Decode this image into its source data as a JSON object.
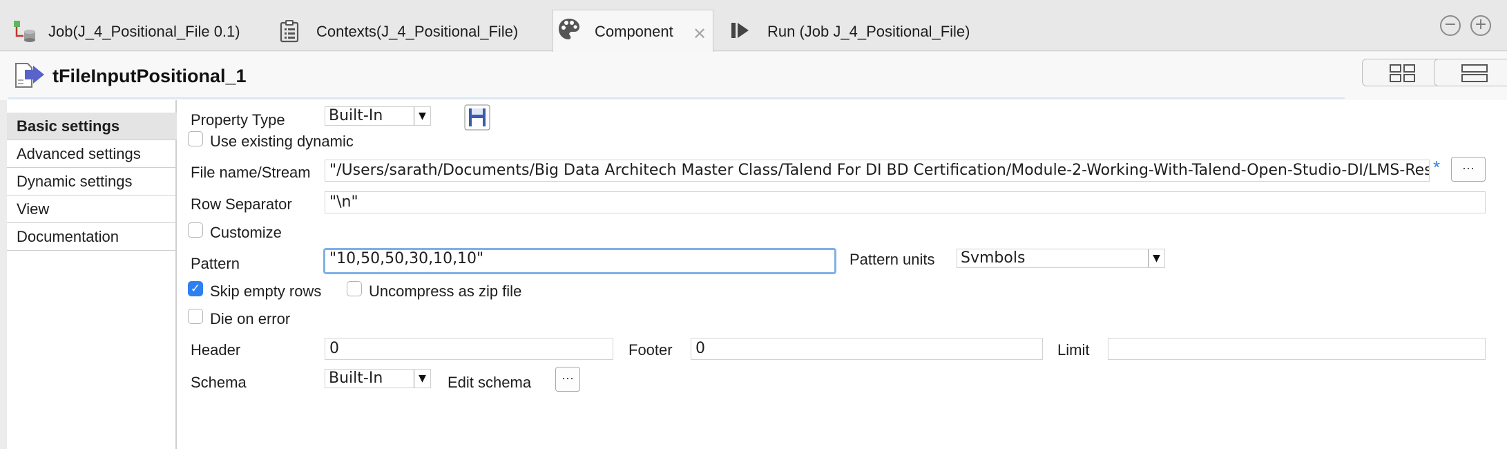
{
  "tabs": [
    {
      "label": "Job(J_4_Positional_File 0.1)",
      "icon": "job-icon"
    },
    {
      "label": "Contexts(J_4_Positional_File)",
      "icon": "clipboard-icon"
    },
    {
      "label": "Component",
      "icon": "palette-icon",
      "close": "✕"
    },
    {
      "label": "Run (Job J_4_Positional_File)",
      "icon": "run-icon"
    }
  ],
  "window_controls": {
    "minimize": "−",
    "maximize": "+"
  },
  "component": {
    "title": "tFileInputPositional_1"
  },
  "sidebar": {
    "items": [
      {
        "label": "Basic settings"
      },
      {
        "label": "Advanced settings"
      },
      {
        "label": "Dynamic settings"
      },
      {
        "label": "View"
      },
      {
        "label": "Documentation"
      }
    ]
  },
  "form": {
    "property_type": {
      "label": "Property Type",
      "value": "Built-In"
    },
    "use_existing_dynamic": {
      "label": "Use existing dynamic",
      "checked": false
    },
    "file_name": {
      "label": "File name/Stream",
      "value": "\"/Users/sarath/Documents/Big Data Architech Master Class/Talend For DI BD Certification/Module-2-Working-With-Talend-Open-Studio-DI/LMS-Resour",
      "modified_marker": "*",
      "browse": "···"
    },
    "row_separator": {
      "label": "Row Separator",
      "value": "\"\\n\""
    },
    "customize": {
      "label": "Customize",
      "checked": false
    },
    "pattern": {
      "label": "Pattern",
      "value": "\"10,50,50,30,10,10\""
    },
    "pattern_units": {
      "label": "Pattern units",
      "value": "Svmbols"
    },
    "skip_empty_rows": {
      "label": "Skip empty rows",
      "checked": true,
      "check_mark": "✓"
    },
    "uncompress_zip": {
      "label": "Uncompress as zip file",
      "checked": false
    },
    "die_on_error": {
      "label": "Die on error",
      "checked": false
    },
    "header": {
      "label": "Header",
      "value": "0"
    },
    "footer": {
      "label": "Footer",
      "value": "0"
    },
    "limit": {
      "label": "Limit",
      "value": ""
    },
    "schema": {
      "label": "Schema",
      "value": "Built-In"
    },
    "edit_schema": {
      "label": "Edit schema",
      "button": "···"
    }
  },
  "colors": {
    "accent": "#2e7ff0",
    "focus_border": "#7fb0e6",
    "component_icon": "#5a63c9"
  }
}
